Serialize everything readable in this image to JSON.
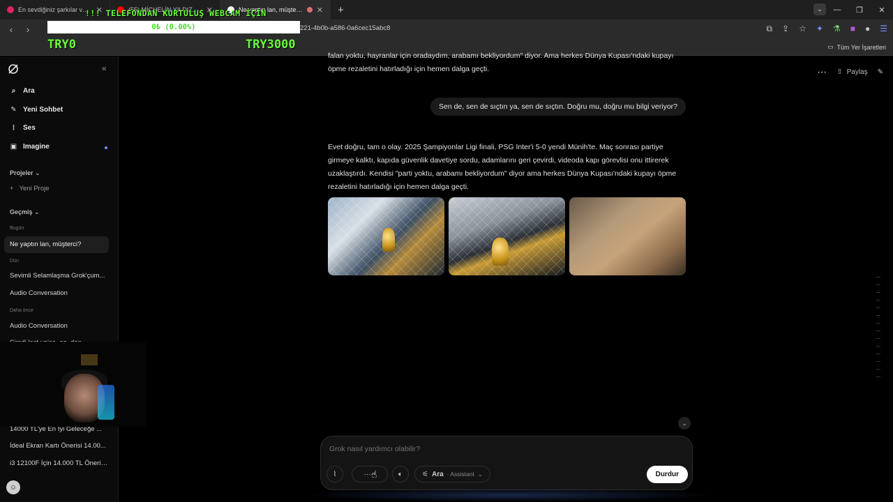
{
  "browser": {
    "tabs": [
      {
        "title": "En sevdiğiniz şarkılar ve albümle...",
        "color": "#e0245e",
        "active": false
      },
      {
        "title": "(55) MİCHELİN YILDIZLI SOKAK...",
        "color": "#ff0000",
        "active": false
      },
      {
        "title": "Ne yaptın lan, müşterci? - Grok",
        "color": "#ffffff",
        "active": true
      }
    ],
    "url": "221-4b0b-a586-0a6cec15abc8",
    "bookmarks_all": "Tüm Yer İşaretleri"
  },
  "overlay": {
    "title": "!!! TELEFONDAN KURTULUŞ WEBCAM İÇİN",
    "progress_label": "0₺ (0.00%)",
    "progress": 0.0,
    "min_label": "TRY0",
    "max_label": "TRY3000"
  },
  "sidebar": {
    "nav": [
      {
        "label": "Ara",
        "icon": "search-icon"
      },
      {
        "label": "Yeni Sohbet",
        "icon": "compose-icon"
      },
      {
        "label": "Ses",
        "icon": "audio-wave-icon"
      },
      {
        "label": "Imagine",
        "icon": "image-icon"
      }
    ],
    "projects_header": "Projeler",
    "new_project": "Yeni Proje",
    "history_header": "Geçmiş",
    "groups": {
      "today": "Bugün",
      "yesterday": "Dün",
      "earlier": "Daha önce"
    },
    "today_items": [
      "Ne yaptın lan, müşterci?"
    ],
    "yesterday_items": [
      "Sevimli Selamlaşma Grok'çum...",
      "Audio Conversation"
    ],
    "earlier_items": [
      "Audio Conversation",
      "Şimdi last voice, ee, den..."
    ],
    "lower_items": [
      "14000 TL'ye En İyi Geleceğe ...",
      "İdeal Ekran Kartı Önerisi 14.00...",
      "i3 12100F İçin 14.000 TL Öneril..."
    ]
  },
  "chat": {
    "share_label": "Paylaş",
    "prev_assistant_partial": "falan yoktu, hayranlar için oradaydım, arabamı bekliyordum\" diyor. Ama herkes Dünya Kupası'ndaki kupayı öpme rezaletini hatırladığı için hemen dalga geçti.",
    "user_message": "Sen de, sen de sıçtın ya, sen de sıçtın. Doğru mu, doğru mu bilgi veriyor?",
    "assistant_message": "Evet doğru, tam o olay. 2025 Şampiyonlar Ligi finali, PSG Inter'i 5-0 yendi Münih'te. Maç sonrası partiye girmeye kalktı, kapıda güvenlik davetiye sordu, adamlarını geri çevirdi, videoda kapı görevlisi onu ittirerek uzaklaştırdı. Kendisi \"parti yoktu, arabamı bekliyordum\" diyor ama herkes Dünya Kupası'ndaki kupayı öpme rezaletini hatırladığı için hemen dalga geçti."
  },
  "composer": {
    "placeholder": "Grok nasıl yardımcı olabilir?",
    "mode_label": "Ara",
    "mode_sub": "· Assistant",
    "stop_label": "Durdur"
  }
}
